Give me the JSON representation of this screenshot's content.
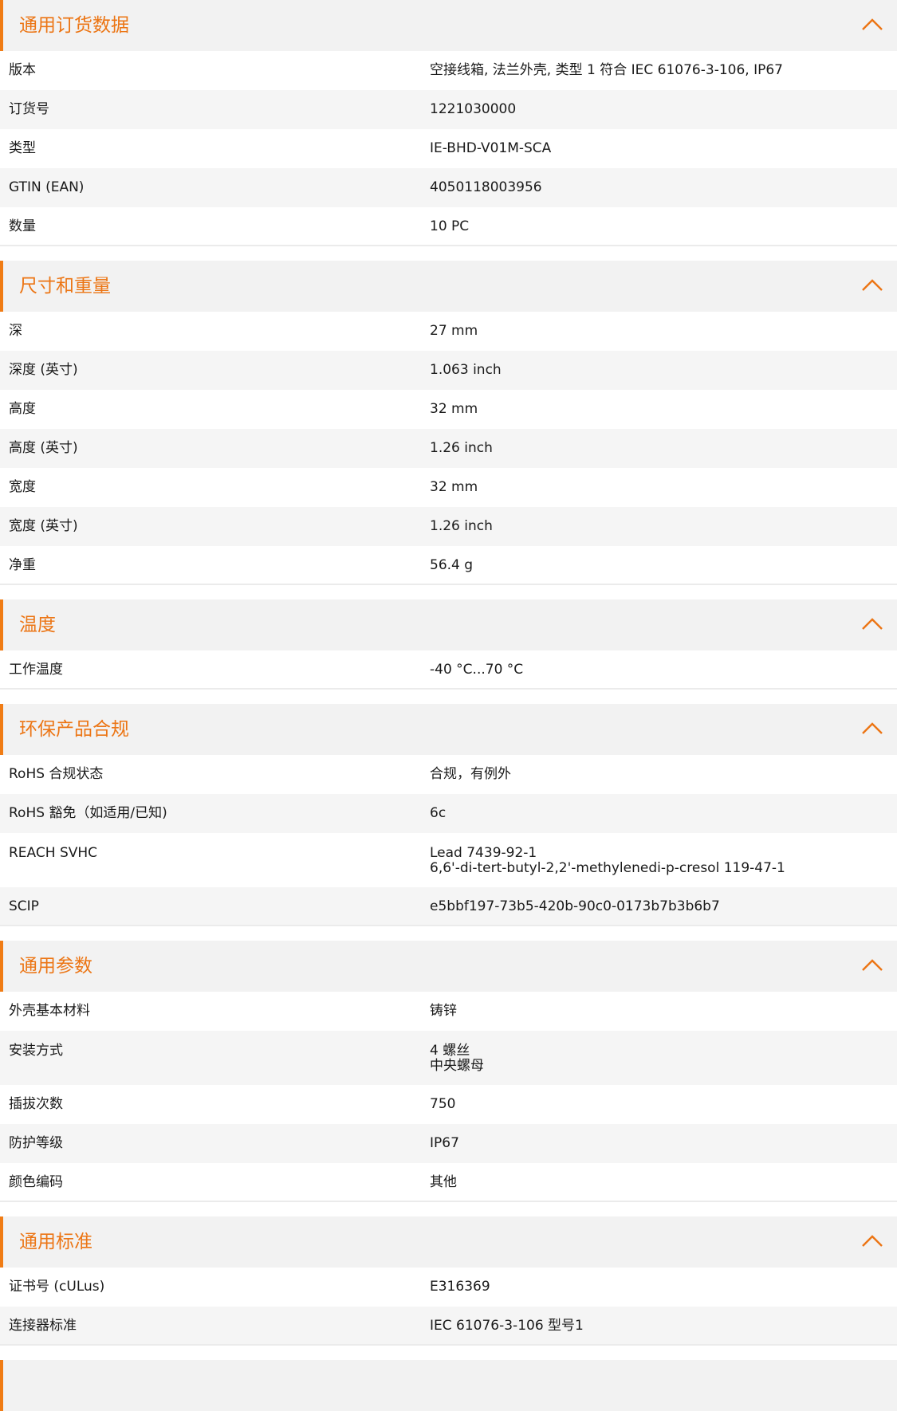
{
  "colors": {
    "accent": "#ec7514",
    "header_bg": "#f2f2f2",
    "row_alt_bg": "#f5f5f5"
  },
  "sections": [
    {
      "title": "通用订货数据",
      "rows": [
        {
          "label": "版本",
          "value": "空接线箱, 法兰外壳, 类型 1 符合 IEC 61076-3-106, IP67"
        },
        {
          "label": "订货号",
          "value": "1221030000"
        },
        {
          "label": "类型",
          "value": "IE-BHD-V01M-SCA"
        },
        {
          "label": "GTIN (EAN)",
          "value": "4050118003956"
        },
        {
          "label": "数量",
          "value": "10  PC"
        }
      ]
    },
    {
      "title": "尺寸和重量",
      "rows": [
        {
          "label": "深",
          "value": "27  mm"
        },
        {
          "label": "深度 (英寸)",
          "value": "1.063  inch"
        },
        {
          "label": "高度",
          "value": "32  mm"
        },
        {
          "label": "高度 (英寸)",
          "value": "1.26  inch"
        },
        {
          "label": "宽度",
          "value": "32  mm"
        },
        {
          "label": "宽度 (英寸)",
          "value": "1.26  inch"
        },
        {
          "label": "净重",
          "value": "56.4  g"
        }
      ]
    },
    {
      "title": "温度",
      "rows": [
        {
          "label": "工作温度",
          "value": "-40 °C...70 °C"
        }
      ]
    },
    {
      "title": "环保产品合规",
      "rows": [
        {
          "label": "RoHS 合规状态",
          "value": "合规，有例外"
        },
        {
          "label": "RoHS 豁免（如适用/已知)",
          "value": "6c"
        },
        {
          "label": "REACH SVHC",
          "value": "Lead 7439-92-1\n6,6'-di-tert-butyl-2,2'-methylenedi-p-cresol 119-47-1"
        },
        {
          "label": "SCIP",
          "value": "e5bbf197-73b5-420b-90c0-0173b7b3b6b7"
        }
      ]
    },
    {
      "title": "通用参数",
      "rows": [
        {
          "label": "外壳基本材料",
          "value": "铸锌"
        },
        {
          "label": "安装方式",
          "value": "4 螺丝\n中央螺母"
        },
        {
          "label": "插拔次数",
          "value": "750"
        },
        {
          "label": "防护等级",
          "value": "IP67"
        },
        {
          "label": "颜色编码",
          "value": "其他"
        }
      ]
    },
    {
      "title": "通用标准",
      "rows": [
        {
          "label": "证书号 (cULus)",
          "value": "E316369"
        },
        {
          "label": "连接器标准",
          "value": "IEC 61076-3-106 型号1"
        }
      ]
    },
    {
      "title": "",
      "rows": []
    }
  ]
}
